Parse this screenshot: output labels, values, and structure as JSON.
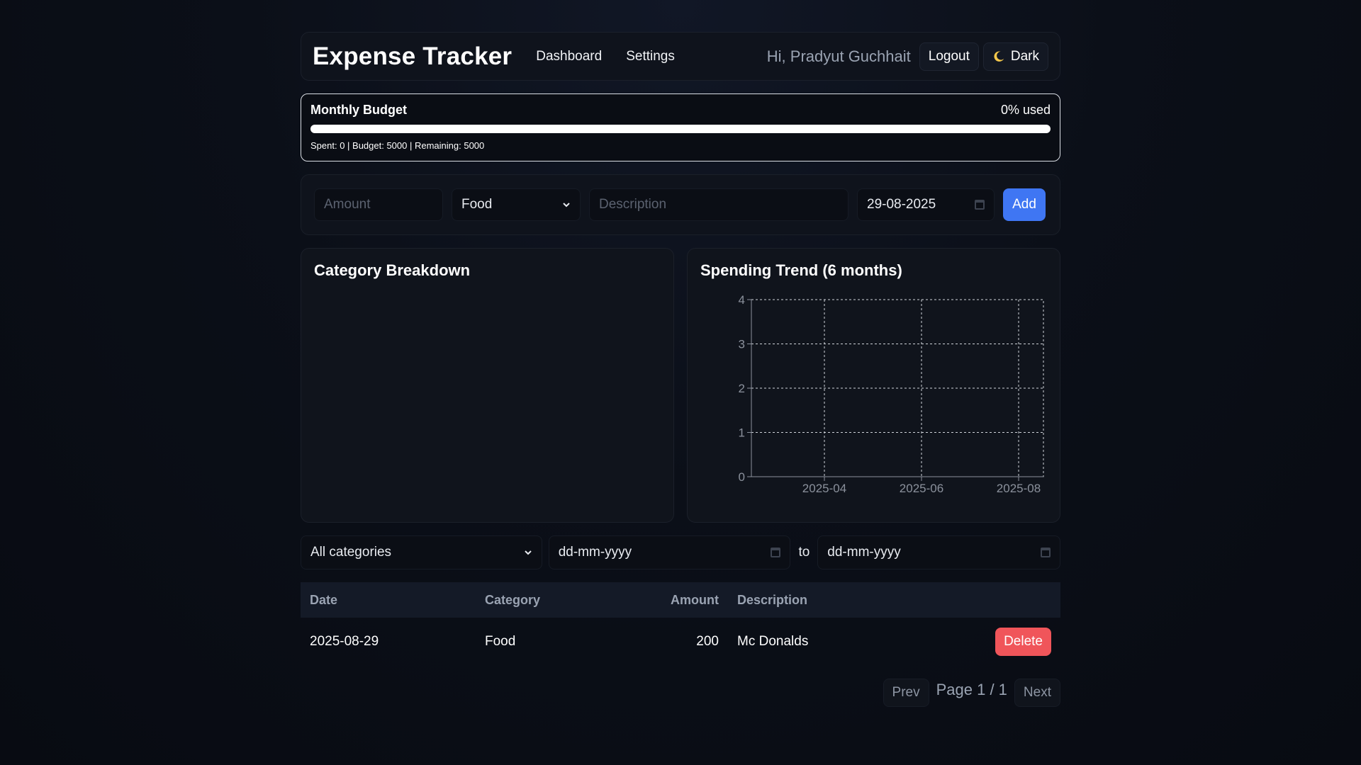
{
  "header": {
    "brand": "Expense Tracker",
    "nav": [
      "Dashboard",
      "Settings"
    ],
    "greeting": "Hi, Pradyut Guchhait",
    "logout": "Logout",
    "theme": "Dark"
  },
  "budget": {
    "title": "Monthly Budget",
    "used_label": "0% used",
    "used_fraction": 0,
    "stats": "Spent: 0 | Budget: 5000 | Remaining: 5000"
  },
  "form": {
    "amount_placeholder": "Amount",
    "category_value": "Food",
    "description_placeholder": "Description",
    "date_value": "29-08-2025",
    "add_label": "Add"
  },
  "charts": {
    "category_title": "Category Breakdown",
    "trend_title": "Spending Trend (6 months)"
  },
  "chart_data": {
    "type": "line",
    "title": "Spending Trend (6 months)",
    "x_ticks": [
      "2025-04",
      "2025-06",
      "2025-08"
    ],
    "y_ticks": [
      0,
      1,
      2,
      3,
      4
    ],
    "ylim": [
      0,
      4
    ],
    "grid": true,
    "series": []
  },
  "filters": {
    "category": "All categories",
    "from_placeholder": "dd-mm-yyyy",
    "to_label": "to",
    "to_placeholder": "dd-mm-yyyy"
  },
  "table": {
    "headers": [
      "Date",
      "Category",
      "Amount",
      "Description"
    ],
    "rows": [
      {
        "date": "2025-08-29",
        "category": "Food",
        "amount": "200",
        "description": "Mc Donalds",
        "action": "Delete"
      }
    ]
  },
  "pagination": {
    "prev": "Prev",
    "info": "Page 1 / 1",
    "next": "Next"
  },
  "colors": {
    "accent": "#3f76f3",
    "danger": "#f0555a"
  }
}
